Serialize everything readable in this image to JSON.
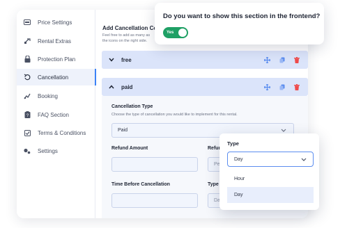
{
  "sidebar": {
    "items": [
      {
        "label": "Price Settings",
        "icon": "price-tag-icon"
      },
      {
        "label": "Rental Extras",
        "icon": "extras-icon"
      },
      {
        "label": "Protection Plan",
        "icon": "lock-icon"
      },
      {
        "label": "Cancellation",
        "icon": "undo-icon",
        "active": true
      },
      {
        "label": "Booking",
        "icon": "booking-icon"
      },
      {
        "label": "FAQ Section",
        "icon": "faq-icon"
      },
      {
        "label": "Terms & Conditions",
        "icon": "checkbox-icon"
      },
      {
        "label": "Settings",
        "icon": "settings-icon"
      }
    ]
  },
  "main": {
    "section_title": "Add Cancellation Con",
    "section_desc_1": "Feel free to add as many as",
    "section_desc_2": "the icons on the right side.",
    "accordions": [
      {
        "label": "free",
        "expanded": false
      },
      {
        "label": "paid",
        "expanded": true
      }
    ],
    "cancellation_type": {
      "label": "Cancellation Type",
      "desc": "Choose the type of cancellation you would like to implement for this rental.",
      "value": "Paid"
    },
    "refund_amount": {
      "label": "Refund Amount",
      "value": ""
    },
    "refund_type": {
      "label": "Refun",
      "value": "Perc"
    },
    "time_before": {
      "label": "Time Before Cancellation",
      "value": ""
    },
    "time_type": {
      "label": "Type",
      "value": "Day"
    }
  },
  "frontend_popup": {
    "question": "Do you want to show this section in the frontend?",
    "toggle_label": "Yes",
    "toggle_on": true,
    "toggle_color": "#1fa065"
  },
  "type_dropdown": {
    "label": "Type",
    "selected": "Day",
    "options": [
      "Hour",
      "Day"
    ],
    "highlighted": "Day"
  },
  "colors": {
    "accent": "#3b82f6",
    "accordion_bg": "#dbe4fa",
    "delete": "#ef4b4b"
  }
}
